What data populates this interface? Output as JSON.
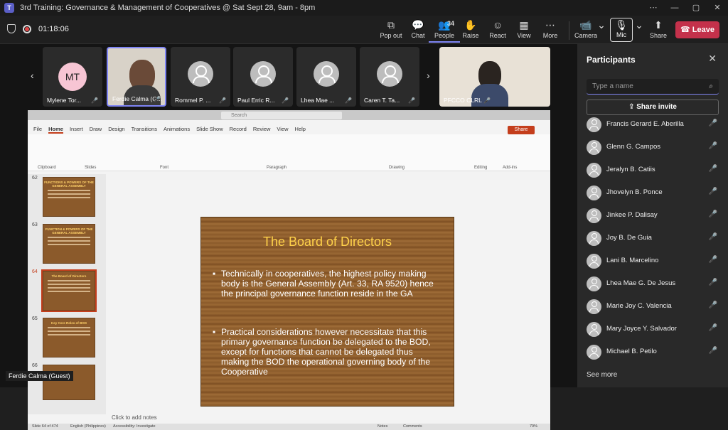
{
  "window": {
    "title": "3rd Training: Governance & Management of Cooperatives @ Sat Sept 28, 9am - 8pm"
  },
  "meeting": {
    "timer": "01:18:06"
  },
  "toolbar": {
    "popout": "Pop out",
    "chat": "Chat",
    "people": "People",
    "people_count": "34",
    "raise": "Raise",
    "react": "React",
    "view": "View",
    "more": "More",
    "camera": "Camera",
    "mic": "Mic",
    "share": "Share",
    "leave": "Leave"
  },
  "tiles": [
    {
      "initials": "MT",
      "name": "Mylene Tor..."
    },
    {
      "name": "Ferdie Calma (G..."
    },
    {
      "name": "Rommel P. ..."
    },
    {
      "name": "Paul Erric R..."
    },
    {
      "name": "Lhea Mae ..."
    },
    {
      "name": "Caren T. Ta..."
    },
    {
      "name": "PFCCO CLRL"
    }
  ],
  "ppt": {
    "menu": [
      "File",
      "Home",
      "Insert",
      "Draw",
      "Design",
      "Transitions",
      "Animations",
      "Slide Show",
      "Record",
      "Review",
      "View",
      "Help"
    ],
    "share": "Share",
    "search": "Search",
    "groups": {
      "clipboard": "Clipboard",
      "slides": "Slides",
      "font": "Font",
      "paragraph": "Paragraph",
      "drawing": "Drawing",
      "editing": "Editing",
      "addins": "Add-ins"
    },
    "thumbs": [
      {
        "num": "62",
        "title": "FUNCTIONS & POWERS OF THE GENERAL ASSEMBLY"
      },
      {
        "num": "63",
        "title": "FUNCTION & POWERS OF THE GENERAL ASSEMBLY"
      },
      {
        "num": "64",
        "title": "The Board of Directors"
      },
      {
        "num": "65",
        "title": "Key Core Roles of BOD"
      },
      {
        "num": "66",
        "title": ""
      }
    ],
    "slide": {
      "title": "The Board of Directors",
      "bullet1": "Technically in cooperatives, the highest policy making body is the General Assembly (Art. 33, RA 9520) hence the principal governance function reside in the GA",
      "bullet2": "Practical considerations however necessitate that this primary governance function be delegated to the BOD, except for functions that cannot be delegated thus making the BOD the operational governing body of the Cooperative"
    },
    "notes": "Click to add notes",
    "status": {
      "slide": "Slide 64 of 474",
      "lang": "English (Philippines)",
      "access": "Accessibility: Investigate",
      "notes": "Notes",
      "comments": "Comments",
      "zoom": "79%"
    }
  },
  "presenter": "Ferdie Calma (Guest)",
  "panel": {
    "title": "Participants",
    "search_placeholder": "Type a name",
    "invite": "Share invite",
    "people": [
      "Francis Gerard E. Aberilla",
      "Glenn G. Campos",
      "Jeralyn B. Catiis",
      "Jhovelyn B. Ponce",
      "Jinkee P. Dalisay",
      "Joy B. De Guia",
      "Lani B. Marcelino",
      "Lhea Mae G. De Jesus",
      "Marie Joy C. Valencia",
      "Mary Joyce Y. Salvador",
      "Michael B. Petilo"
    ],
    "see_more": "See more"
  }
}
